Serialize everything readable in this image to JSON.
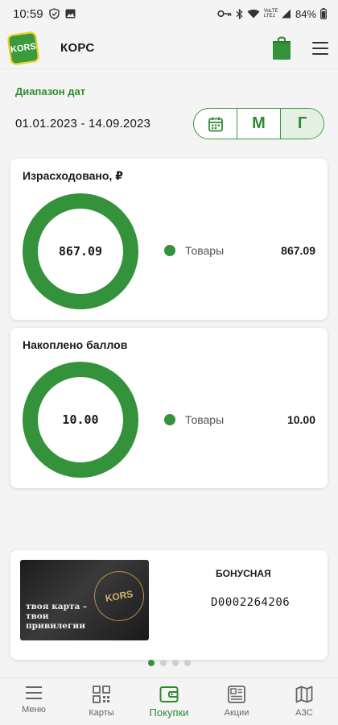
{
  "status_bar": {
    "time": "10:59",
    "battery": "84%",
    "network_label": "VoLTE LTE1"
  },
  "header": {
    "app_title": "КОРС",
    "logo_text": "KORS"
  },
  "date_range": {
    "label": "Диапазон дат",
    "value": "01.01.2023 - 14.09.2023",
    "segments": [
      {
        "id": "calendar",
        "label": "",
        "icon": "calendar-icon"
      },
      {
        "id": "month",
        "label": "М"
      },
      {
        "id": "year",
        "label": "Г",
        "active": true
      }
    ]
  },
  "spent_card": {
    "title": "Израсходовано, ₽",
    "total": "867.09",
    "legend": [
      {
        "label": "Товары",
        "value": "867.09"
      }
    ]
  },
  "points_card": {
    "title": "Накоплено баллов",
    "total": "10.00",
    "legend": [
      {
        "label": "Товары",
        "value": "10.00"
      }
    ]
  },
  "bonus_card": {
    "title": "БОНУСНАЯ",
    "number": "D0002264206",
    "image_slogan": "твоя карта –\nтвои\nпривилегии",
    "image_brand": "KORS"
  },
  "pager": {
    "count": 4,
    "active_index": 0
  },
  "nav": [
    {
      "label": "Меню",
      "icon": "menu-icon"
    },
    {
      "label": "Карты",
      "icon": "qr-icon"
    },
    {
      "label": "Покупки",
      "icon": "wallet-icon",
      "active": true
    },
    {
      "label": "Акции",
      "icon": "promo-icon"
    },
    {
      "label": "АЗС",
      "icon": "map-icon"
    }
  ],
  "colors": {
    "accent": "#34923b",
    "accent_text": "#2f8a33",
    "background": "#f4f4f4"
  }
}
